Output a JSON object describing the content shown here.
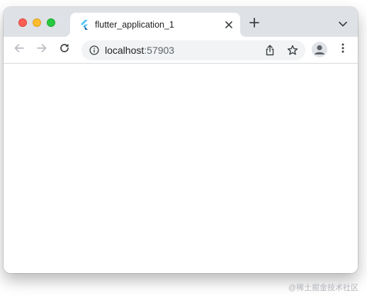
{
  "tab": {
    "title": "flutter_application_1",
    "favicon": "flutter-logo-icon"
  },
  "toolbar": {
    "back_icon": "arrow-left-icon",
    "forward_icon": "arrow-right-icon",
    "reload_icon": "reload-icon"
  },
  "omnibox": {
    "host": "localhost",
    "port": ":57903",
    "info_icon": "info-icon",
    "share_icon": "share-icon",
    "bookmark_icon": "star-icon"
  },
  "watermark": "@稀土掘金技术社区",
  "colors": {
    "tabstrip": "#dee1e6",
    "omnibox": "#f1f3f4",
    "icon": "#5f6368",
    "icon_disabled": "#b9bcc0",
    "flutter_light": "#54c5f8",
    "flutter_dark": "#01579b"
  }
}
